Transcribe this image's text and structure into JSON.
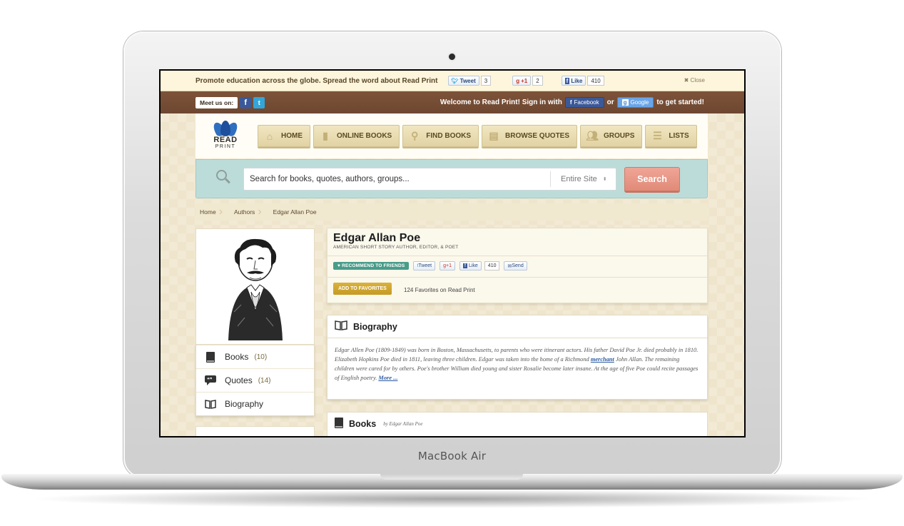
{
  "device": {
    "label": "MacBook Air"
  },
  "promo": {
    "text": "Promote education across the globe. Spread the word about Read Print",
    "tweet_label": "Tweet",
    "tweet_count": "3",
    "gplus_label": "+1",
    "gplus_count": "2",
    "like_label": "Like",
    "like_count": "410",
    "close_label": "✖ Close"
  },
  "topbar": {
    "meet_us": "Meet us on:",
    "welcome_text": "Welcome to Read Print! Sign in with",
    "facebook_btn": "Facebook",
    "or_text": "or",
    "google_btn": "Google",
    "tail_text": "to get started!"
  },
  "logo": {
    "line1": "READ",
    "line2": "PRINT"
  },
  "nav": {
    "home": "HOME",
    "online_books": "ONLINE BOOKS",
    "find_books": "FIND BOOKS",
    "browse_quotes": "BROWSE QUOTES",
    "groups": "GROUPS",
    "lists": "LISTS"
  },
  "search": {
    "placeholder": "Search for books, quotes, authors, groups...",
    "scope": "Entire Site",
    "button": "Search"
  },
  "breadcrumb": {
    "home": "Home",
    "authors": "Authors",
    "current": "Edgar Allan Poe"
  },
  "sidebar": {
    "books_label": "Books",
    "books_count": "(10)",
    "quotes_label": "Quotes",
    "quotes_count": "(14)",
    "biography_label": "Biography"
  },
  "author": {
    "name": "Edgar Allan Poe",
    "subtitle": "AMERICAN SHORT STORY AUTHOR, EDITOR, & POET",
    "recommend": "RECOMMEND TO FRIENDS",
    "tweet": "Tweet",
    "gplus": "+1",
    "like": "Like",
    "like_count": "410",
    "send": "Send",
    "favorites_btn": "ADD TO FAVORITES",
    "favorites_count": "124 Favorites on Read Print"
  },
  "biography": {
    "title": "Biography",
    "text_before": "Edgar Allen Poe (1809-1849) was born in Boston, Massachusetts, to parents who were itinerant actors. His father David Poe Jr. died probably in 1810. Elizabeth Hopkins Poe died in 1811, leaving three children. Edgar was taken into the home of a Richmond",
    "link_word": "merchant",
    "text_after": "John Allan. The remaining children were cared for by others. Poe's brother William died young and sister Rosalie become later insane. At the age of five Poe could recite passages of English poetry.",
    "more": "More ..."
  },
  "books_section": {
    "title": "Books",
    "byline": "by Edgar Allan Poe"
  }
}
